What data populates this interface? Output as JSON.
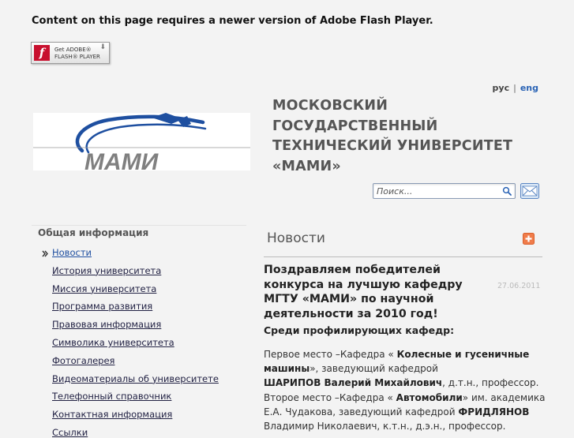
{
  "flash": {
    "message": "Content on this page requires a newer version of Adobe Flash Player.",
    "button_logo": "f",
    "button_line1": "Get ADOBE®",
    "button_line2": "FLASH® PLAYER"
  },
  "lang": {
    "ru": "рус",
    "sep": "|",
    "en": "eng"
  },
  "header": {
    "logo_text": "МАМИ",
    "title_lines": [
      "МОСКОВСКИЙ",
      "ГОСУДАРСТВЕННЫЙ",
      "ТЕХНИЧЕСКИЙ УНИВЕРСИТЕТ",
      "«МАМИ»"
    ]
  },
  "search": {
    "placeholder": "Поиск...",
    "icon": "search-icon",
    "mail_icon": "mail-icon"
  },
  "sidebar": {
    "heading": "Общая информация",
    "items": [
      {
        "label": "Новости"
      },
      {
        "label": "История университета"
      },
      {
        "label": "Миссия университета"
      },
      {
        "label": "Программа развития"
      },
      {
        "label": "Правовая информация"
      },
      {
        "label": "Символика университета"
      },
      {
        "label": "Фотогалерея"
      },
      {
        "label": "Видеоматериалы об университете"
      },
      {
        "label": "Телефонный справочник"
      },
      {
        "label": "Контактная информация"
      },
      {
        "label": "Ссылки"
      }
    ]
  },
  "news": {
    "heading": "Новости",
    "headline": "Поздравляем победителей конкурса на лучшую кафедру МГТУ «МАМИ» по научной деятельности за 2010 год!",
    "date": "27.06.2011",
    "subtitle": "Среди профилирующих кафедр:",
    "p1_a": "Первое место  –Кафедра  «   ",
    "p1_b": "Колесные и гусеничные машины",
    "p1_c": "», заведующий кафедрой   ",
    "p1_d": "ШАРИПОВ Валерий Михайлович",
    "p1_e": ", д.т.н., профессор.",
    "p2_a": "Второе место  –Кафедра  «  ",
    "p2_b": "Автомобили",
    "p2_c": "» им. академика Е.А. Чудакова, заведующий кафедрой ",
    "p2_d": "ФРИДЛЯНОВ",
    "p2_e": " Владимир Николаевич, к.т.н., д.э.н., профессор."
  }
}
